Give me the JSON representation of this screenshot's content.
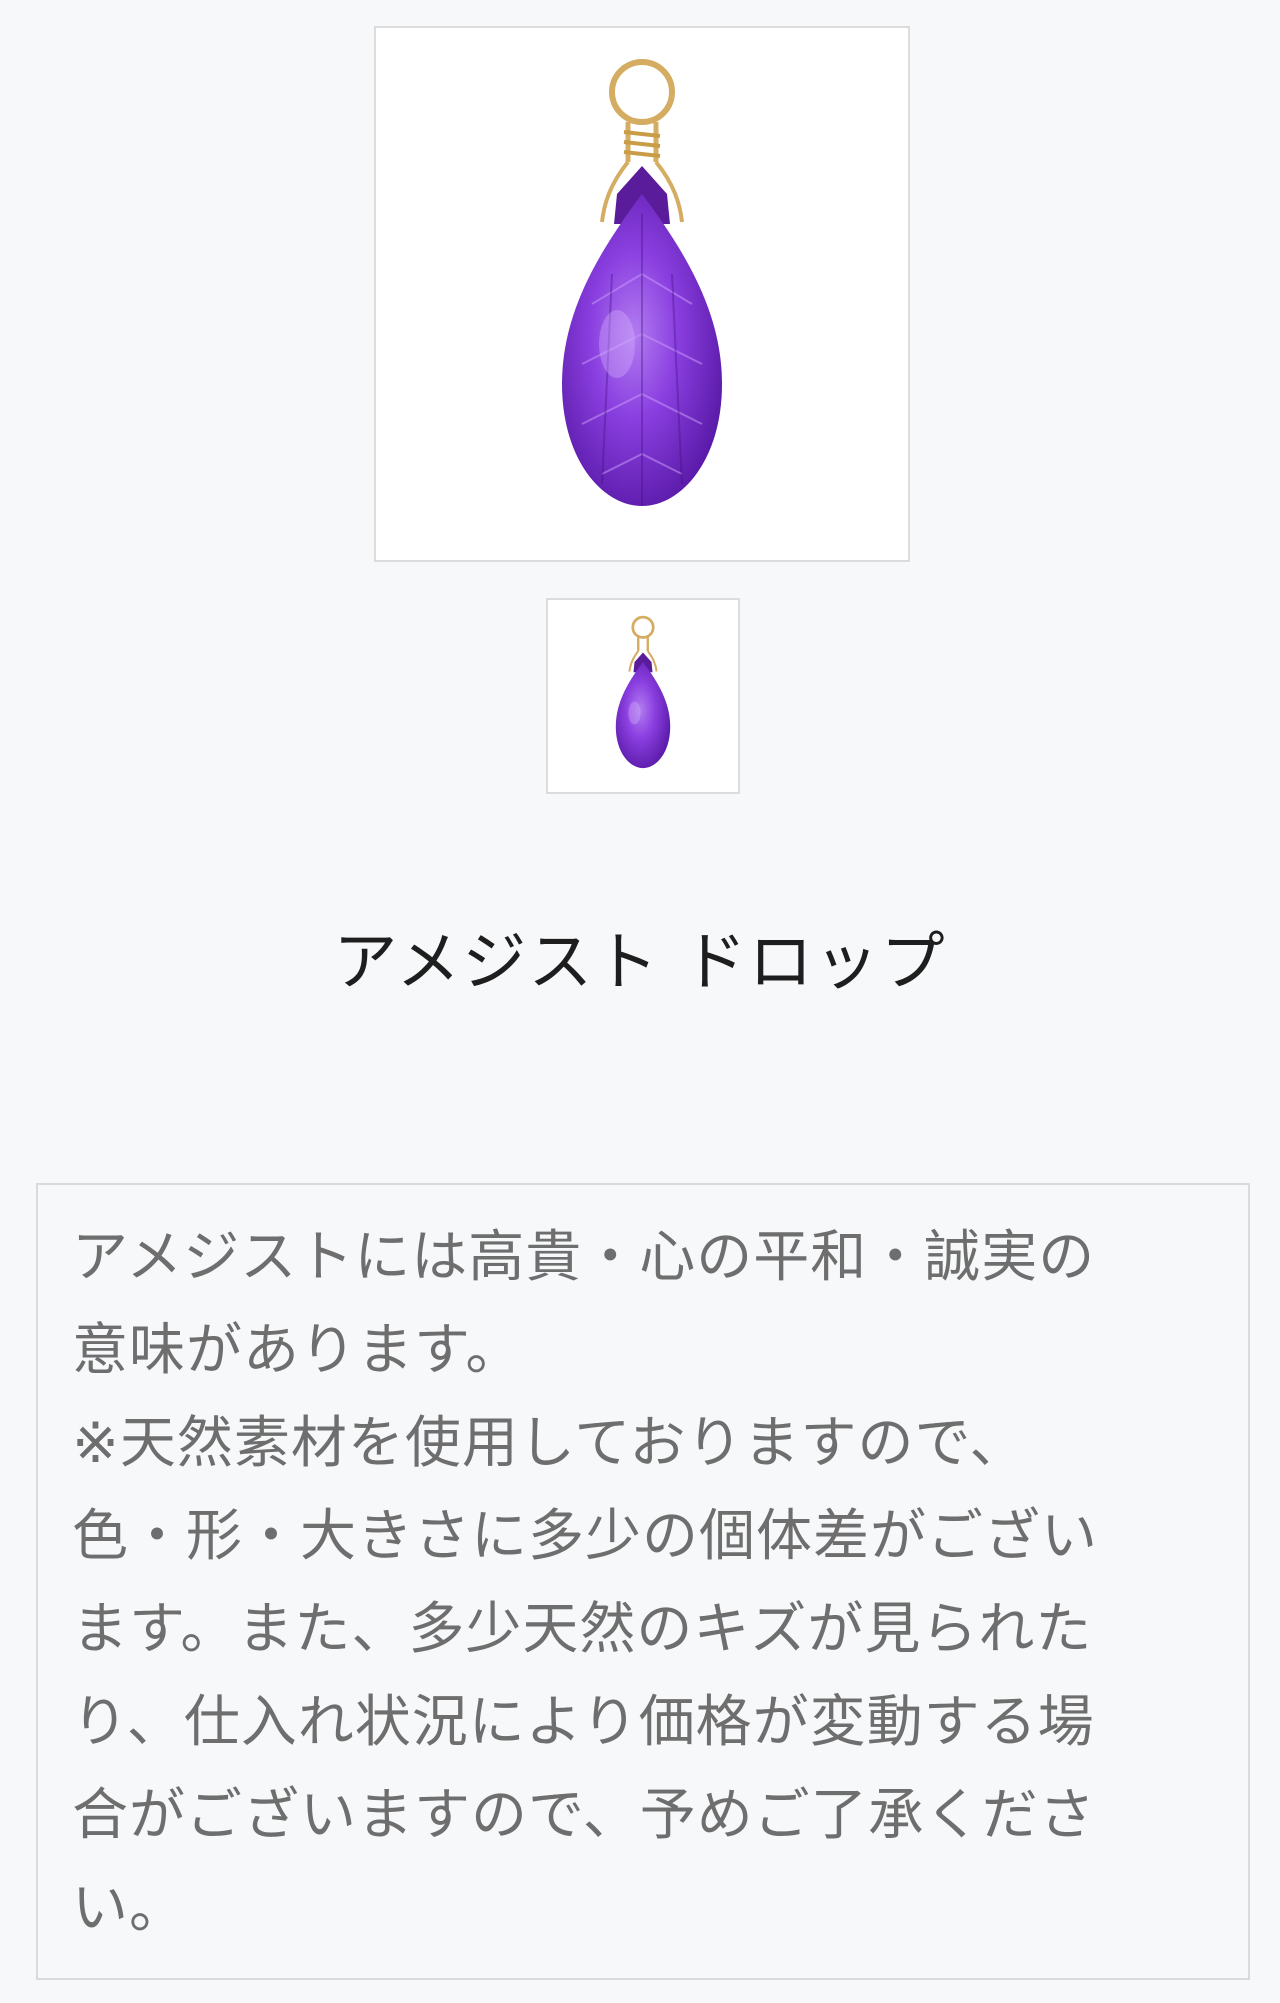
{
  "product": {
    "title": "アメジスト ドロップ",
    "main_image": {
      "icon": "amethyst-drop-pendant-image",
      "gem_color": "#7b2fd6",
      "wire_color": "#d8b26a"
    },
    "thumbnail": {
      "icon": "amethyst-drop-pendant-thumbnail",
      "gem_color": "#7b2fd6",
      "wire_color": "#d8b26a"
    }
  },
  "description": {
    "lines": [
      "アメジストには高貴・心の平和・誠実の",
      "意味があります。",
      "※天然素材を使用しておりますので、",
      "色・形・大きさに多少の個体差がござい",
      "ます。また、多少天然のキズが見られた",
      "り、仕入れ状況により価格が変動する場",
      "合がございますので、予めご了承くださ",
      "い。"
    ]
  }
}
